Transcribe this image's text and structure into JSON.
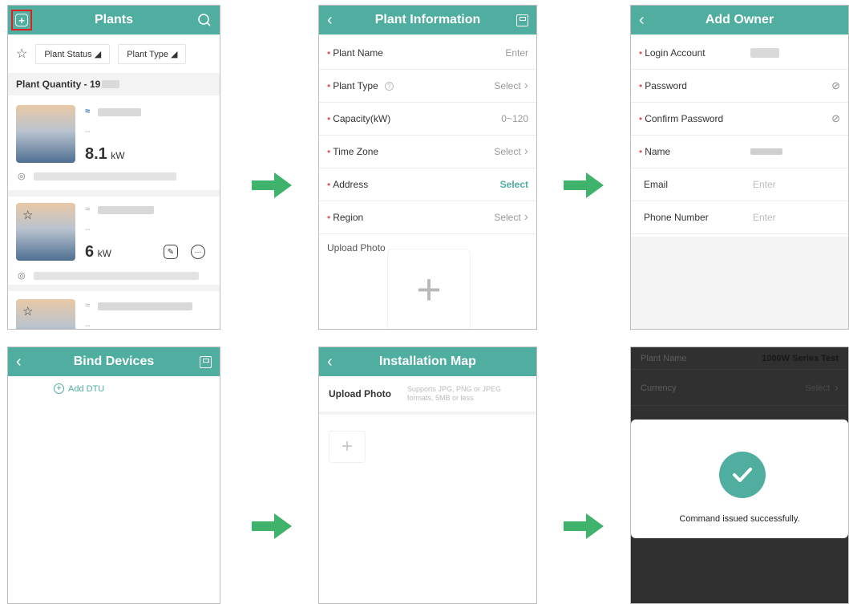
{
  "plants": {
    "title": "Plants",
    "filters": [
      "Plant Status",
      "Plant Type"
    ],
    "quantity": "Plant Quantity - 19",
    "cards": [
      {
        "power": "8.1",
        "unit": "kW",
        "dash": "--"
      },
      {
        "power": "6",
        "unit": "kW",
        "dash": "--"
      },
      {
        "dash": "--"
      }
    ]
  },
  "plant_info": {
    "title": "Plant Information",
    "rows": [
      {
        "label": "Plant Name",
        "value": "Enter"
      },
      {
        "label": "Plant Type",
        "value": "Select"
      },
      {
        "label": "Capacity(kW)",
        "value": "0~120"
      },
      {
        "label": "Time Zone",
        "value": "Select"
      },
      {
        "label": "Address",
        "value": "Select"
      },
      {
        "label": "Region",
        "value": "Select"
      }
    ],
    "upload_label": "Upload Photo"
  },
  "add_owner": {
    "title": "Add Owner",
    "rows": [
      {
        "label": "Login Account"
      },
      {
        "label": "Password"
      },
      {
        "label": "Confirm Password"
      },
      {
        "label": "Name"
      },
      {
        "label": "Email",
        "placeholder": "Enter"
      },
      {
        "label": "Phone Number",
        "placeholder": "Enter"
      }
    ]
  },
  "bind_devices": {
    "title": "Bind Devices",
    "add_label": "Add DTU"
  },
  "install_map": {
    "title": "Installation Map",
    "upload_label": "Upload Photo",
    "hint": "Supports JPG, PNG or JPEG formats, 5MB or less"
  },
  "success": {
    "bg_row1_label": "Plant Name",
    "bg_row1_value": "1000W Series Test",
    "bg_row2_label": "Currency",
    "bg_row2_value": "Select",
    "message": "Command issued successfully."
  },
  "colors": {
    "header": "#4fae9f",
    "arrow": "#3fb36b",
    "highlight": "#e02020",
    "required": "#e25555"
  }
}
